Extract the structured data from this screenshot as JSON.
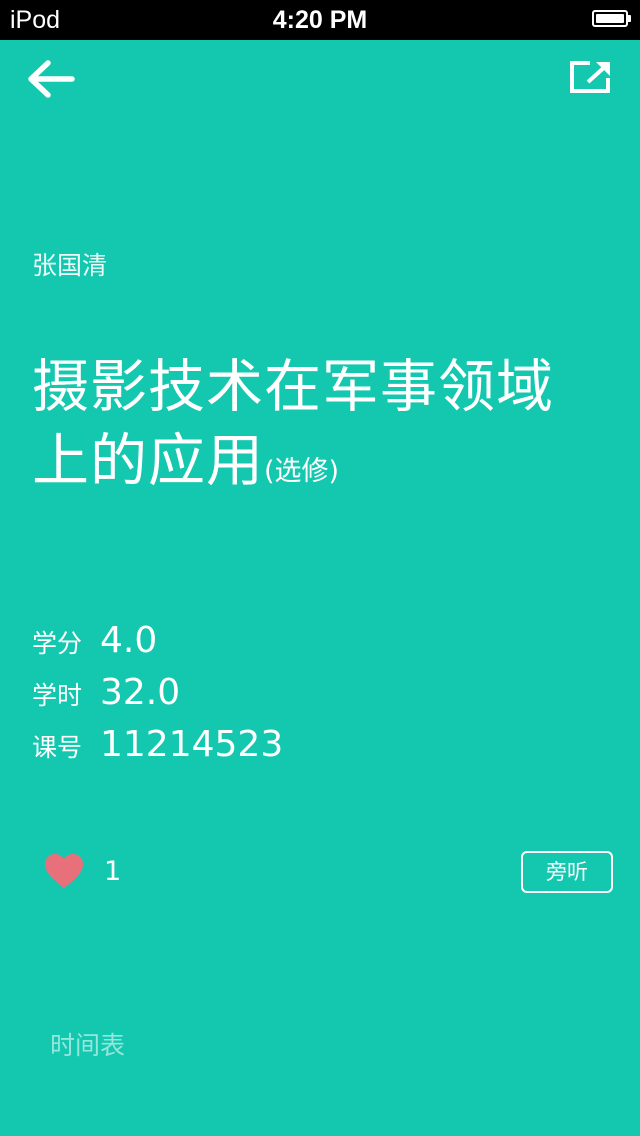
{
  "status_bar": {
    "device": "iPod",
    "time": "4:20 PM",
    "battery_icon": "battery-full-icon"
  },
  "nav": {
    "back_icon": "arrow-left-icon",
    "share_icon": "share-external-icon"
  },
  "course": {
    "teacher": "张国清",
    "title": "摄影技术在军事领域上的应用",
    "title_suffix": "(选修)",
    "info": [
      {
        "label": "学分",
        "value": "4.0"
      },
      {
        "label": "学时",
        "value": "32.0"
      },
      {
        "label": "课号",
        "value": "11214523"
      }
    ]
  },
  "actions": {
    "like_icon": "heart-icon",
    "like_count": "1",
    "audit_label": "旁听"
  },
  "footer": {
    "schedule_label": "时间表"
  },
  "colors": {
    "background": "#14c8b0",
    "heart": "#e8707a",
    "text": "#ffffff"
  }
}
